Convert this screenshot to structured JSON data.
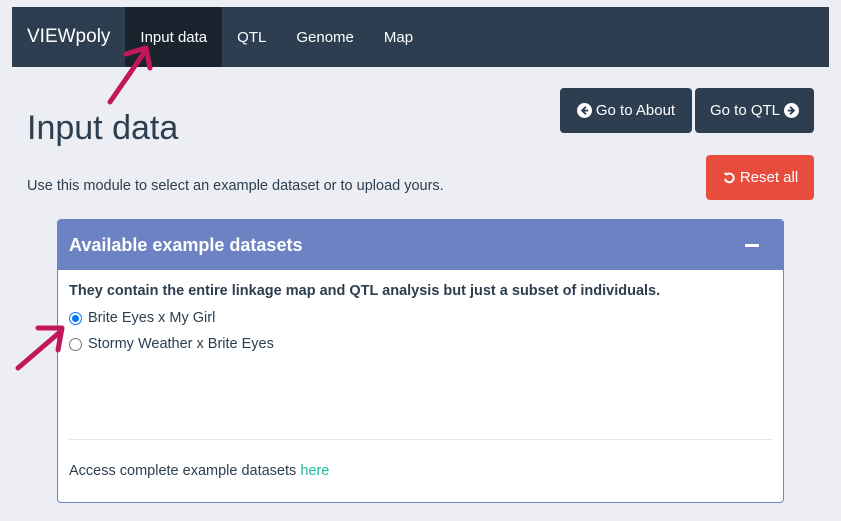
{
  "navbar": {
    "brand": "VIEWpoly",
    "items": [
      {
        "label": "Input data",
        "active": true
      },
      {
        "label": "QTL",
        "active": false
      },
      {
        "label": "Genome",
        "active": false
      },
      {
        "label": "Map",
        "active": false
      }
    ]
  },
  "actions": {
    "go_about_label": "Go to About",
    "go_qtl_label": "Go to QTL",
    "reset_label": "Reset all"
  },
  "page": {
    "title": "Input data",
    "intro": "Use this module to select an example dataset or to upload yours."
  },
  "panel": {
    "title": "Available example datasets",
    "description": "They contain the entire linkage map and QTL analysis but just a subset of individuals.",
    "options": [
      {
        "label": "Brite Eyes x My Girl",
        "selected": true
      },
      {
        "label": "Stormy Weather x Brite Eyes",
        "selected": false
      }
    ],
    "footer_text": "Access complete example datasets ",
    "footer_link": "here"
  },
  "colors": {
    "navbar": "#2c3e50",
    "panel_header": "#6c82c2",
    "reset": "#e74c3c",
    "link": "#18bc9c",
    "annotation_arrow": "#c2185b"
  }
}
